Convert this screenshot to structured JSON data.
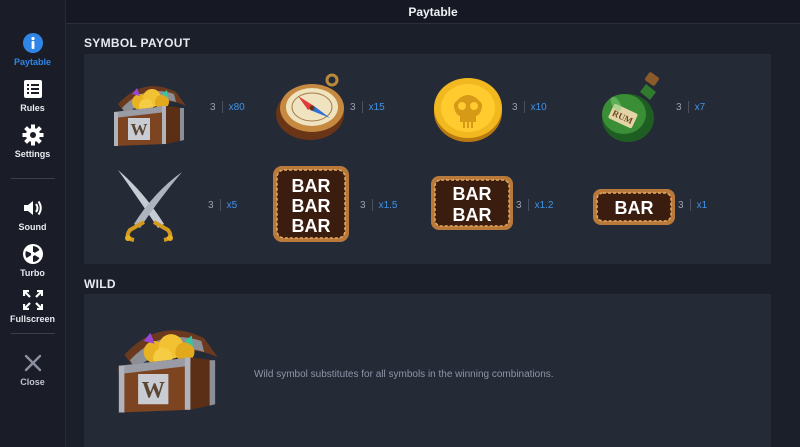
{
  "topbar": {
    "title": "Paytable"
  },
  "sidebar": {
    "items": [
      {
        "label": "Paytable",
        "icon": "info-icon",
        "active": true
      },
      {
        "label": "Rules",
        "icon": "list-icon"
      },
      {
        "label": "Settings",
        "icon": "gear-icon"
      },
      {
        "label": "Sound",
        "icon": "speaker-icon"
      },
      {
        "label": "Turbo",
        "icon": "turbo-icon"
      },
      {
        "label": "Fullscreen",
        "icon": "fullscreen-icon"
      },
      {
        "label": "Close",
        "icon": "close-icon"
      }
    ]
  },
  "symbol_payout": {
    "heading": "SYMBOL PAYOUT",
    "symbols": [
      {
        "name": "treasure-chest",
        "count": "3",
        "multiplier": "x80"
      },
      {
        "name": "compass",
        "count": "3",
        "multiplier": "x15"
      },
      {
        "name": "skull-coin",
        "count": "3",
        "multiplier": "x10"
      },
      {
        "name": "rum-bottle",
        "count": "3",
        "multiplier": "x7"
      },
      {
        "name": "crossed-swords",
        "count": "3",
        "multiplier": "x5"
      },
      {
        "name": "triple-bar",
        "count": "3",
        "multiplier": "x1.5"
      },
      {
        "name": "double-bar",
        "count": "3",
        "multiplier": "x1.2"
      },
      {
        "name": "single-bar",
        "count": "3",
        "multiplier": "x1"
      }
    ],
    "bar_text": "BAR",
    "rum_text": "RUM",
    "chest_letter": "W"
  },
  "wild": {
    "heading": "WILD",
    "description": "Wild symbol substitutes for all symbols in the winning combinations.",
    "chest_letter": "W"
  },
  "colors": {
    "accent": "#2f86e6",
    "multiplier": "#3f93ea",
    "panel": "#252a37"
  }
}
